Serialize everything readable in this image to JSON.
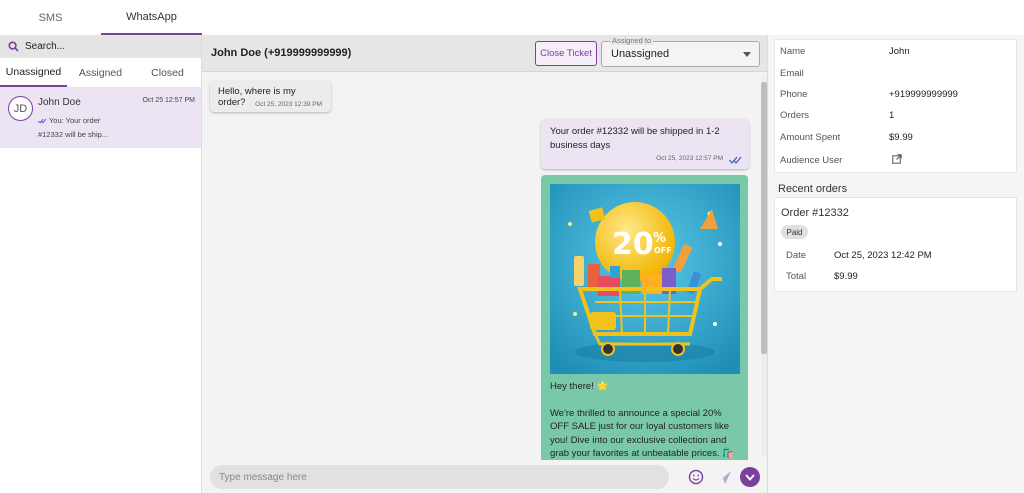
{
  "top_tabs": [
    {
      "label": "SMS",
      "active": false
    },
    {
      "label": "WhatsApp",
      "active": true
    }
  ],
  "search": {
    "placeholder": "Search..."
  },
  "filter_tabs": [
    {
      "label": "Unassigned",
      "active": true
    },
    {
      "label": "Assigned",
      "active": false
    },
    {
      "label": "Closed",
      "active": false
    }
  ],
  "conversation": {
    "initials": "JD",
    "name": "John Doe",
    "time": "Oct 25 12:57 PM",
    "preview_line1": "You: Your order",
    "preview_line2": "#12332 will be ship..."
  },
  "chat": {
    "title": "John Doe (+919999999999)",
    "close_ticket_label": "Close Ticket",
    "assigned_label": "Assigned to",
    "assigned_value": "Unassigned",
    "incoming": {
      "text": "Hello, where is my order?",
      "time": "Oct 25, 2023 12:39 PM"
    },
    "outgoing": {
      "text": "Your order #12332 will be shipped in 1-2 business days",
      "time": "Oct 25, 2023 12:57 PM"
    },
    "promo": {
      "badge_number": "20",
      "badge_percent": "%",
      "badge_off": "OFF",
      "greeting": "Hey there! 🌟",
      "body": "We're thrilled to announce a special 20% OFF SALE just for our loyal customers like you! Dive into our exclusive collection and grab your favorites at unbeatable prices. 🛍️ ✨"
    },
    "composer_placeholder": "Type message here"
  },
  "profile": {
    "rows": [
      {
        "label": "Name",
        "value": "John"
      },
      {
        "label": "Email",
        "value": ""
      },
      {
        "label": "Phone",
        "value": "+919999999999"
      },
      {
        "label": "Orders",
        "value": "1"
      },
      {
        "label": "Amount Spent",
        "value": "$9.99"
      },
      {
        "label": "Audience User",
        "value": ""
      }
    ]
  },
  "recent_orders": {
    "title": "Recent orders",
    "order_number": "Order #12332",
    "status": "Paid",
    "date_label": "Date",
    "date_value": "Oct 25, 2023 12:42 PM",
    "total_label": "Total",
    "total_value": "$9.99"
  },
  "colors": {
    "accent": "#7b3f9d",
    "incoming_bubble": "#ececec",
    "outgoing_bubble": "#ece4f2",
    "promo_bubble": "#79c9a9",
    "read_ticks": "#3a57c7"
  },
  "icons": [
    "search-icon",
    "double-check-icon",
    "emoji-icon",
    "send-icon",
    "chevron-down-icon",
    "external-link-icon"
  ]
}
